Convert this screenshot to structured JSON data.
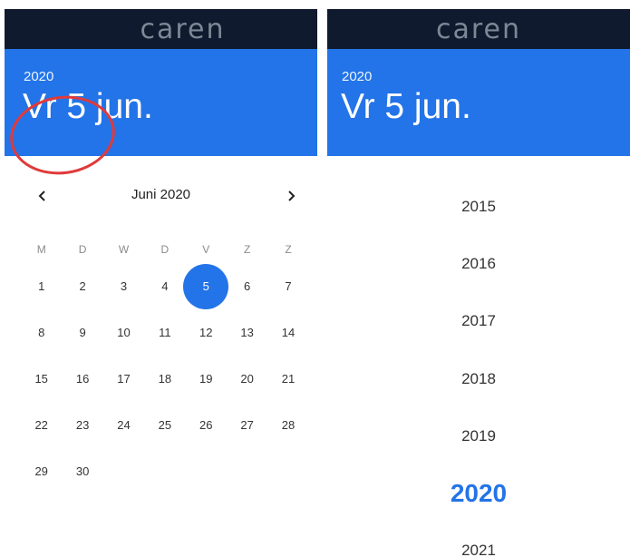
{
  "brand": "caren",
  "header": {
    "year": "2020",
    "date": "Vr 5 jun."
  },
  "calendar": {
    "month_label": "Juni 2020",
    "weekdays": [
      "M",
      "D",
      "W",
      "D",
      "V",
      "Z",
      "Z"
    ],
    "weeks": [
      [
        "1",
        "2",
        "3",
        "4",
        "5",
        "6",
        "7"
      ],
      [
        "8",
        "9",
        "10",
        "11",
        "12",
        "13",
        "14"
      ],
      [
        "15",
        "16",
        "17",
        "18",
        "19",
        "20",
        "21"
      ],
      [
        "22",
        "23",
        "24",
        "25",
        "26",
        "27",
        "28"
      ],
      [
        "29",
        "30",
        "",
        "",
        "",
        "",
        ""
      ]
    ],
    "selected_day": "5"
  },
  "year_list": [
    "2015",
    "2016",
    "2017",
    "2018",
    "2019",
    "2020",
    "2021"
  ],
  "active_year": "2020",
  "colors": {
    "accent": "#2374e8",
    "brand_bar": "#101a2e",
    "annotation": "#e03a3a"
  }
}
